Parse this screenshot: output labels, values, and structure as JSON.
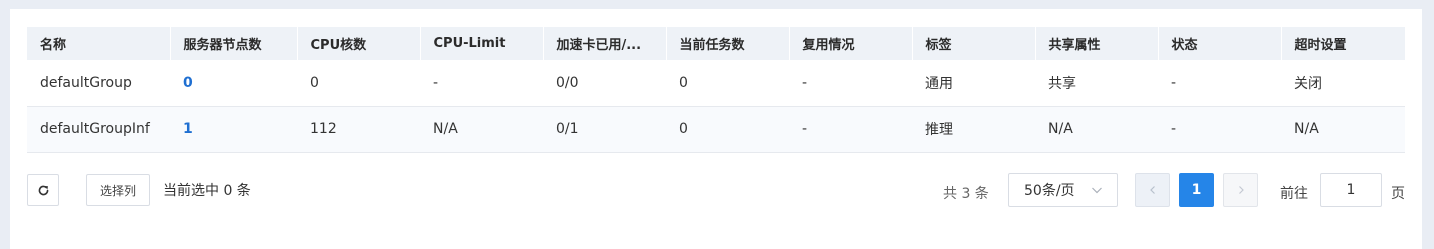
{
  "table": {
    "columns": [
      "名称",
      "服务器节点数",
      "CPU核数",
      "CPU-Limit",
      "加速卡已用/...",
      "当前任务数",
      "复用情况",
      "标签",
      "共享属性",
      "状态",
      "超时设置"
    ],
    "rows": [
      [
        "defaultGroup",
        "0",
        "0",
        "-",
        "0/0",
        "0",
        "-",
        "通用",
        "共享",
        "-",
        "关闭"
      ],
      [
        "defaultGroupInf",
        "1",
        "112",
        "N/A",
        "0/1",
        "0",
        "-",
        "推理",
        "N/A",
        "-",
        "N/A"
      ]
    ]
  },
  "footer": {
    "refresh_icon": "refresh-icon",
    "select_columns_label": "选择列",
    "selected_text": "当前选中 0 条",
    "total_text": "共 3 条",
    "page_size_value": "50条/页",
    "current_page": "1",
    "goto_label": "前往",
    "goto_value": "1",
    "goto_unit": "页"
  },
  "colors": {
    "accent": "#2585e8",
    "link": "#1f6fd1",
    "header_bg": "#eef2f7",
    "page_bg": "#e9edf4"
  }
}
